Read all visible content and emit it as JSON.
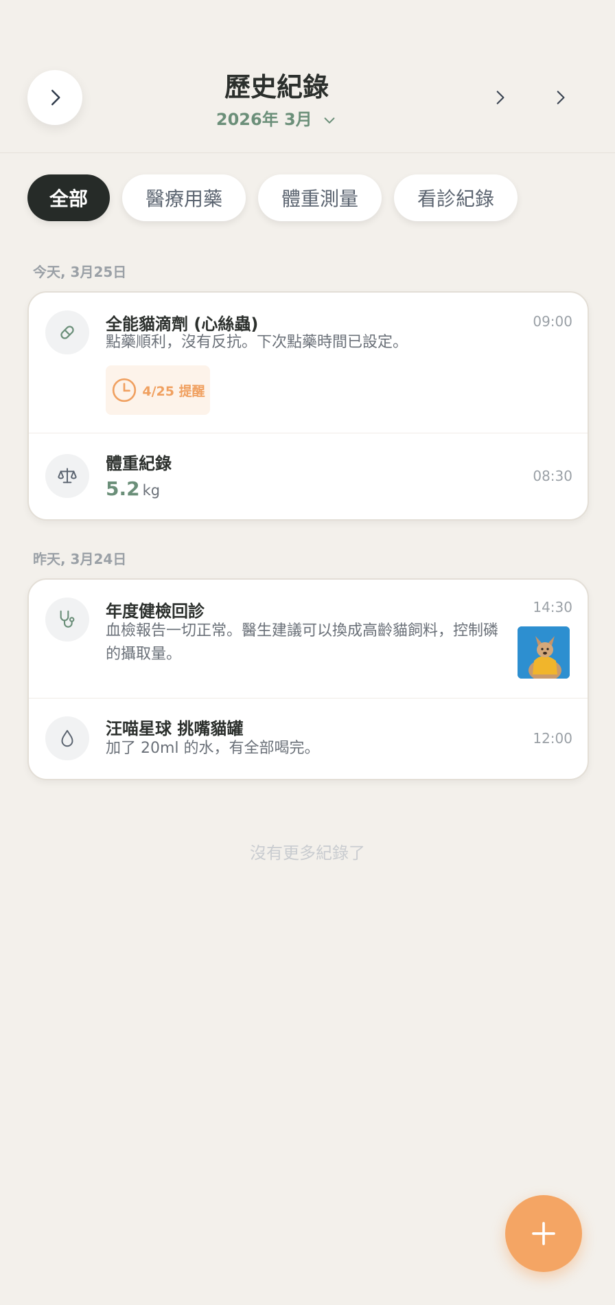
{
  "header": {
    "title": "歷史紀錄",
    "month": "2026年 3月"
  },
  "filters": [
    {
      "label": "全部",
      "active": true
    },
    {
      "label": "醫療用藥",
      "active": false
    },
    {
      "label": "體重測量",
      "active": false
    },
    {
      "label": "看診紀錄",
      "active": false
    }
  ],
  "groups": [
    {
      "date": "今天, 3月25日",
      "entries": [
        {
          "icon": "pill-icon",
          "title": "全能貓滴劑 (心絲蟲)",
          "desc": "點藥順利，沒有反抗。下次點藥時間已設定。",
          "time": "09:00",
          "reminder": "4/25 提醒"
        },
        {
          "icon": "scale-icon",
          "title": "體重紀錄",
          "value": "5.2",
          "unit": "kg",
          "time": "08:30"
        }
      ]
    },
    {
      "date": "昨天, 3月24日",
      "entries": [
        {
          "icon": "stethoscope-icon",
          "title": "年度健檢回診",
          "desc_lines": [
            "血檢報告一切正常。醫生建議可以換成高齡貓飼料，控制磷",
            "的攝取量。"
          ],
          "time": "14:30",
          "thumbnail": "dog-photo"
        },
        {
          "icon": "water-drop-icon",
          "title": "汪喵星球 挑嘴貓罐",
          "desc": "加了 20ml 的水，有全部喝完。",
          "time": "12:00"
        }
      ]
    }
  ],
  "end_text": "沒有更多紀錄了",
  "colors": {
    "background": "#f3f0eb",
    "accent_green": "#6b8f79",
    "accent_orange": "#f4a564",
    "chip_active": "#262b28"
  }
}
